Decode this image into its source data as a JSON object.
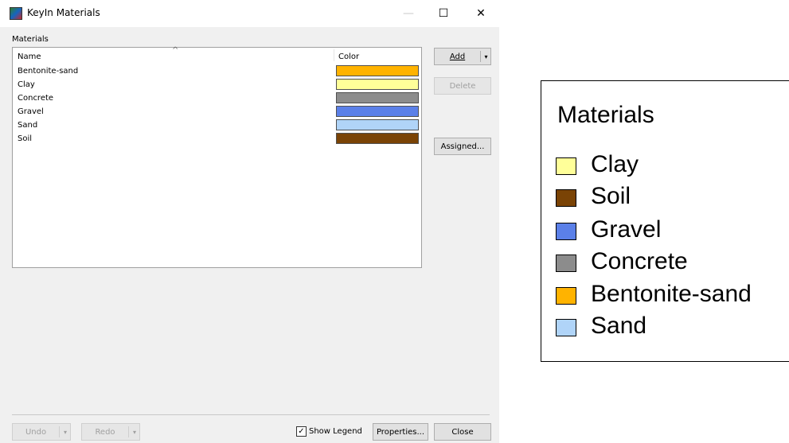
{
  "window": {
    "title": "KeyIn Materials",
    "minimize_icon": "minimize-icon",
    "maximize_icon": "maximize-icon",
    "close_icon": "close-icon",
    "min_glyph": "—",
    "max_glyph": "☐",
    "close_glyph": "✕"
  },
  "materials": {
    "group_label": "Materials",
    "columns": {
      "name": "Name",
      "color": "Color",
      "sort_glyph": "^"
    },
    "rows": [
      {
        "name": "Bentonite-sand",
        "color": "#ffb300"
      },
      {
        "name": "Clay",
        "color": "#ffff99"
      },
      {
        "name": "Concrete",
        "color": "#8c8c8c"
      },
      {
        "name": "Gravel",
        "color": "#5b80e8"
      },
      {
        "name": "Sand",
        "color": "#b0d4f8"
      },
      {
        "name": "Soil",
        "color": "#7a4305"
      }
    ]
  },
  "buttons": {
    "add": "Add",
    "delete": "Delete",
    "assigned": "Assigned...",
    "undo": "Undo",
    "redo": "Redo",
    "properties": "Properties...",
    "close": "Close",
    "dropdown_glyph": "▾"
  },
  "show_legend": {
    "label": "Show Legend",
    "checked": true,
    "check_glyph": "✓"
  },
  "legend": {
    "title": "Materials",
    "items": [
      {
        "label": "Clay",
        "color": "#ffff99"
      },
      {
        "label": "Soil",
        "color": "#7a4305"
      },
      {
        "label": "Gravel",
        "color": "#5b80e8"
      },
      {
        "label": "Concrete",
        "color": "#8c8c8c"
      },
      {
        "label": "Bentonite-sand",
        "color": "#ffb300"
      },
      {
        "label": "Sand",
        "color": "#b0d4f8"
      }
    ]
  }
}
